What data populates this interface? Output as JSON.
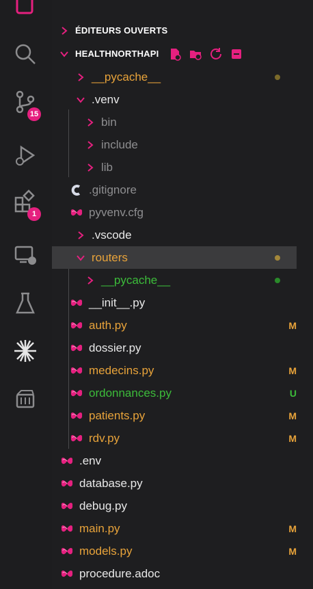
{
  "activity_bar": {
    "source_control_badge": "15",
    "extensions_badge": "1"
  },
  "explorer": {
    "open_editors_label": "ÉDITEURS OUVERTS",
    "project_label": "HEALTHNORTHAPI",
    "items": [
      {
        "name": "__pycache__",
        "color": "#e8a33a",
        "status": "",
        "dot": "#7b6a2a"
      },
      {
        "name": ".venv",
        "color": "#e8e8e8",
        "status": "",
        "dot": ""
      },
      {
        "name": "bin",
        "color": "#8e8e90",
        "status": "",
        "dot": ""
      },
      {
        "name": "include",
        "color": "#8e8e90",
        "status": "",
        "dot": ""
      },
      {
        "name": "lib",
        "color": "#8e8e90",
        "status": "",
        "dot": ""
      },
      {
        "name": ".gitignore",
        "color": "#8e8e90",
        "status": "",
        "dot": ""
      },
      {
        "name": "pyvenv.cfg",
        "color": "#8e8e90",
        "status": "",
        "dot": ""
      },
      {
        "name": ".vscode",
        "color": "#e8e8e8",
        "status": "",
        "dot": ""
      },
      {
        "name": "routers",
        "color": "#e8a33a",
        "status": "",
        "dot": "#a3873a"
      },
      {
        "name": "__pycache__",
        "color": "#3cbc3a",
        "status": "",
        "dot": "#2a8a2a"
      },
      {
        "name": "__init__.py",
        "color": "#e8e8e8",
        "status": "",
        "dot": ""
      },
      {
        "name": "auth.py",
        "color": "#e8a33a",
        "status": "M",
        "dot": ""
      },
      {
        "name": "dossier.py",
        "color": "#e8e8e8",
        "status": "",
        "dot": ""
      },
      {
        "name": "medecins.py",
        "color": "#e8a33a",
        "status": "M",
        "dot": ""
      },
      {
        "name": "ordonnances.py",
        "color": "#3cbc3a",
        "status": "U",
        "dot": ""
      },
      {
        "name": "patients.py",
        "color": "#e8a33a",
        "status": "M",
        "dot": ""
      },
      {
        "name": "rdv.py",
        "color": "#e8a33a",
        "status": "M",
        "dot": ""
      },
      {
        "name": ".env",
        "color": "#e8e8e8",
        "status": "",
        "dot": ""
      },
      {
        "name": "database.py",
        "color": "#e8e8e8",
        "status": "",
        "dot": ""
      },
      {
        "name": "debug.py",
        "color": "#e8e8e8",
        "status": "",
        "dot": ""
      },
      {
        "name": "main.py",
        "color": "#e8a33a",
        "status": "M",
        "dot": ""
      },
      {
        "name": "models.py",
        "color": "#e8a33a",
        "status": "M",
        "dot": ""
      },
      {
        "name": "procedure.adoc",
        "color": "#e8e8e8",
        "status": "",
        "dot": ""
      }
    ]
  },
  "colors": {
    "accent_pink": "#e5207f",
    "modified": "#e8a33a",
    "untracked": "#3cbc3a"
  }
}
